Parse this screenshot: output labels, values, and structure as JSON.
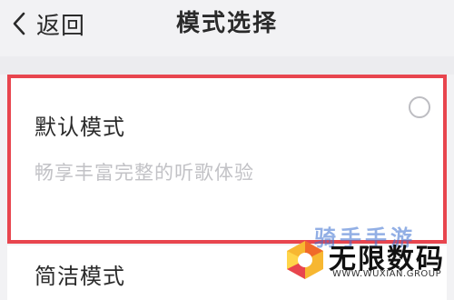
{
  "header": {
    "back_label": "返回",
    "title": "模式选择"
  },
  "options": [
    {
      "name": "默认模式",
      "description": "畅享丰富完整的听歌体验",
      "selected": true
    },
    {
      "name": "简洁模式"
    }
  ],
  "watermark": {
    "top_text": "骑手手游",
    "name": "无限数码",
    "url": "WWW.WUXIAN.GROUP"
  },
  "colors": {
    "accent": "#e8454e",
    "background": "#f2f2f4",
    "text": "#2a2a2a",
    "muted": "#c2c2c6"
  }
}
